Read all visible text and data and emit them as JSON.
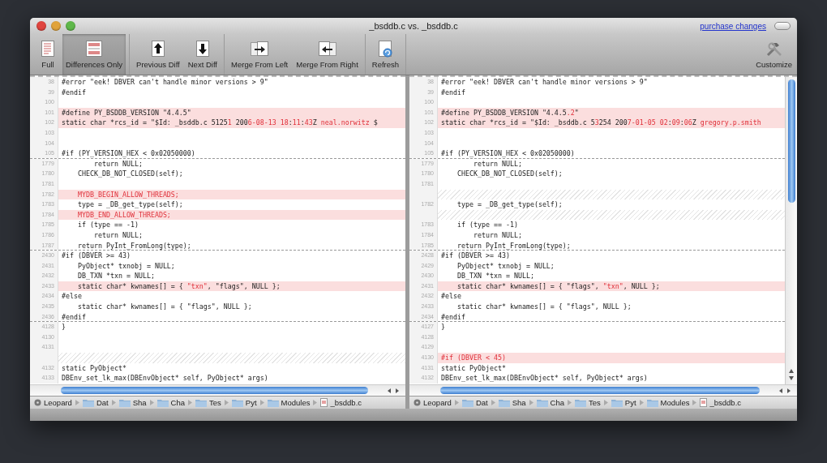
{
  "window": {
    "title": "_bsddb.c vs. _bsddb.c",
    "link": "purchase changes"
  },
  "toolbar": {
    "groups": [
      [
        {
          "label": "Full",
          "kind": "full",
          "selected": false
        },
        {
          "label": "Differences Only",
          "kind": "diff_only",
          "selected": true
        }
      ],
      [
        {
          "label": "Previous Diff",
          "kind": "prev",
          "selected": false
        },
        {
          "label": "Next Diff",
          "kind": "next",
          "selected": false
        }
      ],
      [
        {
          "label": "Merge From Left",
          "kind": "merge_left",
          "selected": false
        },
        {
          "label": "Merge From Right",
          "kind": "merge_right",
          "selected": false
        }
      ],
      [
        {
          "label": "Refresh",
          "kind": "refresh",
          "selected": false
        }
      ]
    ],
    "end": [
      {
        "label": "Customize",
        "kind": "customize",
        "selected": false
      }
    ]
  },
  "panes": [
    {
      "lines": [
        {
          "num": "38",
          "kind": "line",
          "text": "#error \"eek! DBVER can't handle minor versions > 9\""
        },
        {
          "num": "39",
          "kind": "line",
          "text": "#endif"
        },
        {
          "num": "100",
          "kind": "line"
        },
        {
          "num": "101",
          "kind": "changed",
          "text": "#define PY_BSDDB_VERSION \"4.4.5\""
        },
        {
          "num": "102",
          "kind": "changed",
          "parts": [
            {
              "text": "static char *rcs_id = \"$Id: _bsddb.c 5125",
              "changed": false
            },
            {
              "text": "1",
              "changed": true
            },
            {
              "text": " 200",
              "changed": false
            },
            {
              "text": "6-08-13 18",
              "changed": true
            },
            {
              "text": ":",
              "changed": false
            },
            {
              "text": "11",
              "changed": true
            },
            {
              "text": ":",
              "changed": false
            },
            {
              "text": "43",
              "changed": true
            },
            {
              "text": "Z ",
              "changed": false
            },
            {
              "text": "neal.norwitz",
              "changed": true
            },
            {
              "text": " $",
              "changed": false
            }
          ]
        },
        {
          "num": "103",
          "kind": "line"
        },
        {
          "num": "104",
          "kind": "line"
        },
        {
          "num": "105",
          "kind": "line",
          "text": "#if (PY_VERSION_HEX < 0x02050000)",
          "divider_after": true
        },
        {
          "num": "1779",
          "kind": "line",
          "text": "        return NULL;"
        },
        {
          "num": "1780",
          "kind": "line",
          "text": "    CHECK_DB_NOT_CLOSED(self);"
        },
        {
          "num": "1781",
          "kind": "line"
        },
        {
          "num": "1782",
          "kind": "changed",
          "parts": [
            {
              "text": "    MYDB_BEGIN_ALLOW_THREADS;",
              "changed": true
            }
          ]
        },
        {
          "num": "1783",
          "kind": "line",
          "text": "    type = _DB_get_type(self);"
        },
        {
          "num": "1784",
          "kind": "changed",
          "parts": [
            {
              "text": "    MYDB_END_ALLOW_THREADS;",
              "changed": true
            }
          ]
        },
        {
          "num": "1785",
          "kind": "line",
          "text": "    if (type == -1)"
        },
        {
          "num": "1786",
          "kind": "line",
          "text": "        return NULL;"
        },
        {
          "num": "1787",
          "kind": "line",
          "text": "    return PyInt_FromLong(type);",
          "divider_after": true
        },
        {
          "num": "2430",
          "kind": "line",
          "text": "#if (DBVER >= 43)"
        },
        {
          "num": "2431",
          "kind": "line",
          "text": "    PyObject* txnobj = NULL;"
        },
        {
          "num": "2432",
          "kind": "line",
          "text": "    DB_TXN *txn = NULL;"
        },
        {
          "num": "2433",
          "kind": "changed",
          "parts": [
            {
              "text": "    static char* kwnames[] = { ",
              "changed": false
            },
            {
              "text": "\"txn\"",
              "changed": true
            },
            {
              "text": ", \"flags\", NULL };",
              "changed": false
            }
          ]
        },
        {
          "num": "2434",
          "kind": "line",
          "text": "#else"
        },
        {
          "num": "2435",
          "kind": "line",
          "text": "    static char* kwnames[] = { \"flags\", NULL };"
        },
        {
          "num": "2436",
          "kind": "line",
          "text": "#endif",
          "divider_after": true
        },
        {
          "num": "4128",
          "kind": "line",
          "text": "}"
        },
        {
          "num": "4130",
          "kind": "line"
        },
        {
          "num": "4131",
          "kind": "line"
        },
        {
          "kind": "gap"
        },
        {
          "num": "4132",
          "kind": "line",
          "text": "static PyObject*"
        },
        {
          "num": "4133",
          "kind": "line",
          "text": "DBEnv_set_lk_max(DBEnvObject* self, PyObject* args)"
        }
      ],
      "breadcrumbs": [
        {
          "label": "Leopard",
          "kind": "disk"
        },
        {
          "label": "Dat",
          "kind": "folder"
        },
        {
          "label": "Sha",
          "kind": "folder"
        },
        {
          "label": "Cha",
          "kind": "folder"
        },
        {
          "label": "Tes",
          "kind": "folder"
        },
        {
          "label": "Pyt",
          "kind": "folder"
        },
        {
          "label": "Modules",
          "kind": "folder"
        },
        {
          "label": "_bsddb.c",
          "kind": "file"
        }
      ]
    },
    {
      "vertical_scrollbar": true,
      "lines": [
        {
          "num": "38",
          "kind": "line",
          "text": "#error \"eek! DBVER can't handle minor versions > 9\""
        },
        {
          "num": "39",
          "kind": "line",
          "text": "#endif"
        },
        {
          "num": "100",
          "kind": "line"
        },
        {
          "num": "101",
          "kind": "changed",
          "parts": [
            {
              "text": "#define PY_BSDDB_VERSION \"4.4.5",
              "changed": false
            },
            {
              "text": ".2",
              "changed": true
            },
            {
              "text": "\"",
              "changed": false
            }
          ]
        },
        {
          "num": "102",
          "kind": "changed",
          "parts": [
            {
              "text": "static char *rcs_id = \"$Id: _bsddb.c 5",
              "changed": false
            },
            {
              "text": "3",
              "changed": true
            },
            {
              "text": "254 200",
              "changed": false
            },
            {
              "text": "7-01-05 02",
              "changed": true
            },
            {
              "text": ":",
              "changed": false
            },
            {
              "text": "09",
              "changed": true
            },
            {
              "text": ":",
              "changed": false
            },
            {
              "text": "06",
              "changed": true
            },
            {
              "text": "Z ",
              "changed": false
            },
            {
              "text": "gregory.p.smith",
              "changed": true
            }
          ]
        },
        {
          "num": "103",
          "kind": "line"
        },
        {
          "num": "104",
          "kind": "line"
        },
        {
          "num": "105",
          "kind": "line",
          "text": "#if (PY_VERSION_HEX < 0x02050000)",
          "divider_after": true
        },
        {
          "num": "1779",
          "kind": "line",
          "text": "        return NULL;"
        },
        {
          "num": "1780",
          "kind": "line",
          "text": "    CHECK_DB_NOT_CLOSED(self);"
        },
        {
          "num": "1781",
          "kind": "line"
        },
        {
          "kind": "gap"
        },
        {
          "num": "1782",
          "kind": "line",
          "text": "    type = _DB_get_type(self);"
        },
        {
          "kind": "gap"
        },
        {
          "num": "1783",
          "kind": "line",
          "text": "    if (type == -1)"
        },
        {
          "num": "1784",
          "kind": "line",
          "text": "        return NULL;"
        },
        {
          "num": "1785",
          "kind": "line",
          "text": "    return PyInt_FromLong(type);",
          "divider_after": true
        },
        {
          "num": "2428",
          "kind": "line",
          "text": "#if (DBVER >= 43)"
        },
        {
          "num": "2429",
          "kind": "line",
          "text": "    PyObject* txnobj = NULL;"
        },
        {
          "num": "2430",
          "kind": "line",
          "text": "    DB_TXN *txn = NULL;"
        },
        {
          "num": "2431",
          "kind": "changed",
          "parts": [
            {
              "text": "    static char* kwnames[] = { \"flags\", ",
              "changed": false
            },
            {
              "text": "\"txn\"",
              "changed": true
            },
            {
              "text": ", NULL };",
              "changed": false
            }
          ]
        },
        {
          "num": "2432",
          "kind": "line",
          "text": "#else"
        },
        {
          "num": "2433",
          "kind": "line",
          "text": "    static char* kwnames[] = { \"flags\", NULL };"
        },
        {
          "num": "2434",
          "kind": "line",
          "text": "#endif",
          "divider_after": true
        },
        {
          "num": "4127",
          "kind": "line",
          "text": "}"
        },
        {
          "num": "4128",
          "kind": "line"
        },
        {
          "num": "4129",
          "kind": "line"
        },
        {
          "num": "4130",
          "kind": "changed",
          "parts": [
            {
              "text": "#if (DBVER < 45)",
              "changed": true
            }
          ]
        },
        {
          "num": "4131",
          "kind": "line",
          "text": "static PyObject*"
        },
        {
          "num": "4132",
          "kind": "line",
          "text": "DBEnv_set_lk_max(DBEnvObject* self, PyObject* args)"
        }
      ],
      "breadcrumbs": [
        {
          "label": "Leopard",
          "kind": "disk"
        },
        {
          "label": "Dat",
          "kind": "folder"
        },
        {
          "label": "Sha",
          "kind": "folder"
        },
        {
          "label": "Cha",
          "kind": "folder"
        },
        {
          "label": "Tes",
          "kind": "folder"
        },
        {
          "label": "Pyt",
          "kind": "folder"
        },
        {
          "label": "Modules",
          "kind": "folder"
        },
        {
          "label": "_bsddb.c",
          "kind": "file"
        }
      ]
    }
  ]
}
